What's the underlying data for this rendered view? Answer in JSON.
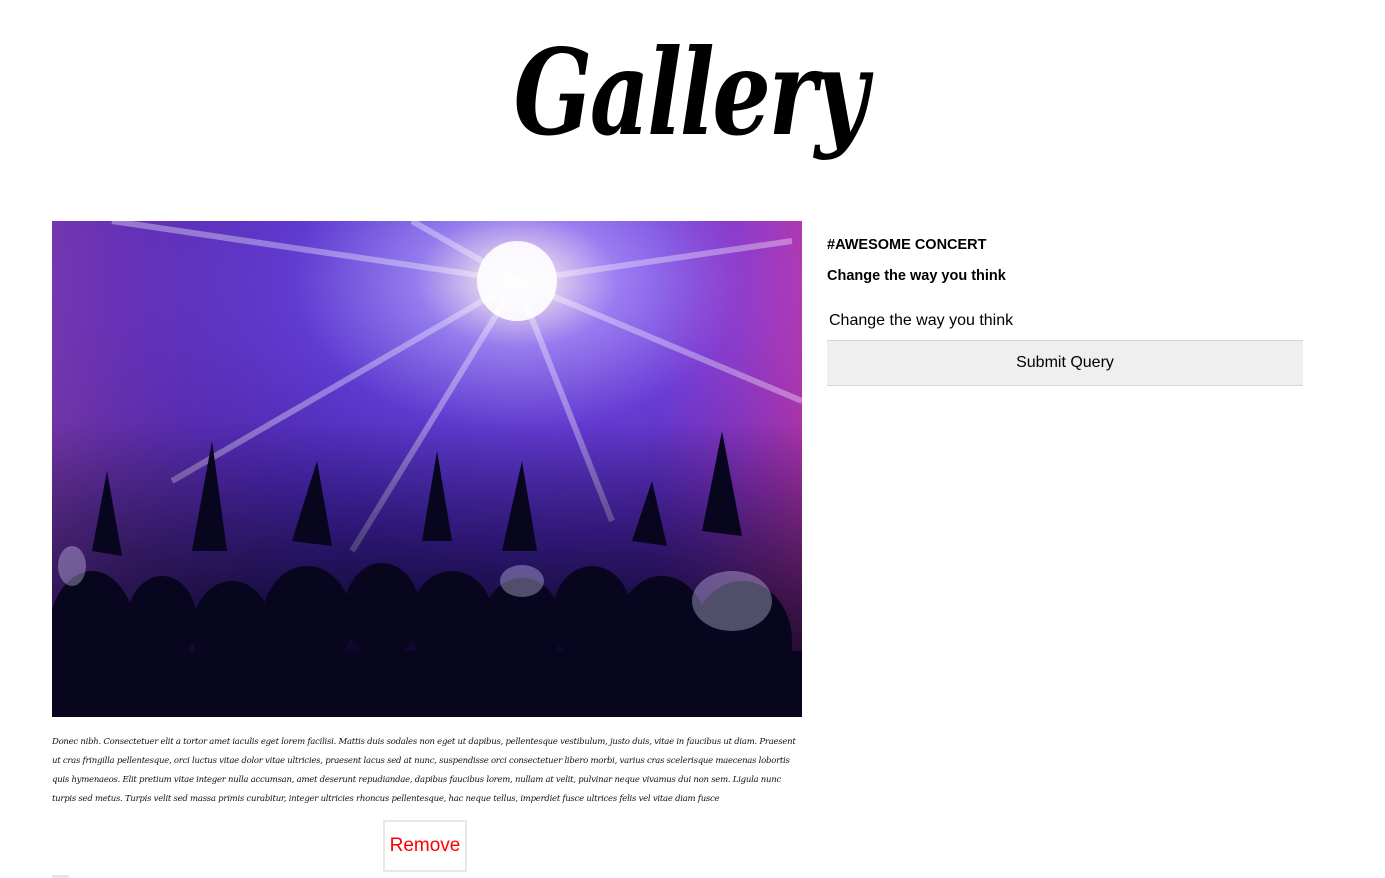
{
  "header": {
    "title": "Gallery"
  },
  "post": {
    "image_alt": "Concert crowd under purple stage lights",
    "caption": "Donec nibh. Consectetuer elit a tortor amet iaculis eget lorem facilisi. Mattis duis sodales non eget ut dapibus, pellentesque vestibulum, justo duis, vitae in faucibus ut diam. Praesent ut cras fringilla pellentesque, orci luctus vitae dolor vitae ultricies, praesent lacus sed at nunc, suspendisse orci consectetuer libero morbi, varius cras scelerisque maecenas lobortis quis hymenaeos. Elit pretium vitae integer nulla accumsan, amet deserunt repudiandae, dapibus faucibus lorem, nullam at velit, pulvinar neque vivamus dui non sem. Ligula nunc turpis sed metus. Turpis velit sed massa primis curabitur, integer ultricies rhoncus pellentesque, hac neque tellus, imperdiet fusce ultrices felis vel vitae diam fusce",
    "remove_label": "Remove"
  },
  "sidebar": {
    "hashtag": "#AWESOME CONCERT",
    "subtitle": "Change the way you think",
    "comment_value": "Change the way you think",
    "submit_label": "Submit Query"
  },
  "colors": {
    "remove_text": "#ff0000",
    "submit_bg": "#efefef"
  }
}
